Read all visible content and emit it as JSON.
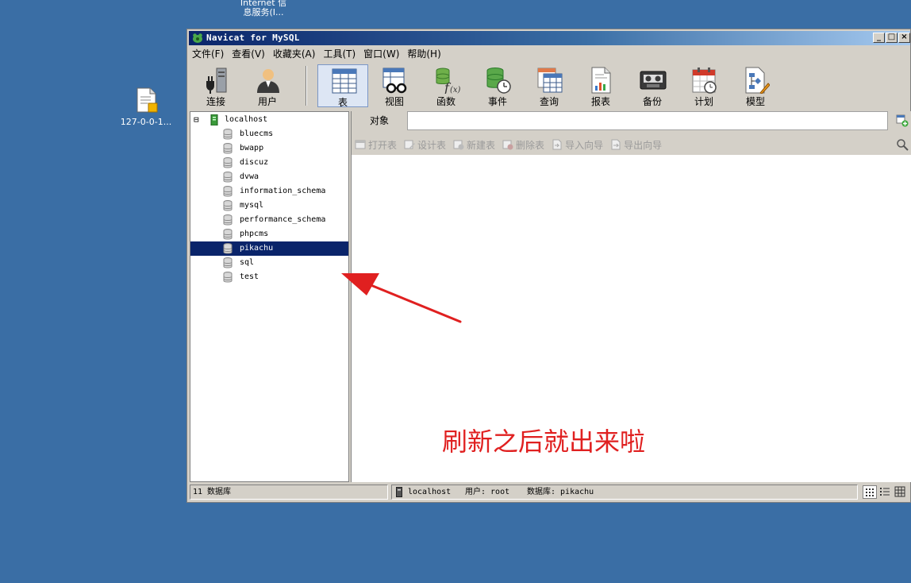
{
  "desktop": {
    "top_icon_label_line1": "Internet 信",
    "top_icon_label_line2": "息服务(I...",
    "file_icon_label": "127-0-0-1..."
  },
  "window": {
    "title": "Navicat for MySQL",
    "min_glyph": "_",
    "max_glyph": "□",
    "close_glyph": "×"
  },
  "menu": [
    "文件(F)",
    "查看(V)",
    "收藏夹(A)",
    "工具(T)",
    "窗口(W)",
    "帮助(H)"
  ],
  "toolbar": [
    {
      "label": "连接",
      "icon": "plug-server-icon"
    },
    {
      "label": "用户",
      "icon": "user-icon"
    },
    {
      "label": "表",
      "icon": "table-icon",
      "active": true
    },
    {
      "label": "视图",
      "icon": "view-glasses-icon"
    },
    {
      "label": "函数",
      "icon": "function-icon"
    },
    {
      "label": "事件",
      "icon": "event-clock-icon"
    },
    {
      "label": "查询",
      "icon": "query-table-icon"
    },
    {
      "label": "报表",
      "icon": "report-icon"
    },
    {
      "label": "备份",
      "icon": "backup-tape-icon"
    },
    {
      "label": "计划",
      "icon": "schedule-calendar-icon"
    },
    {
      "label": "模型",
      "icon": "model-diagram-icon"
    }
  ],
  "tree": {
    "root": "localhost",
    "expander": "⊟",
    "databases": [
      "bluecms",
      "bwapp",
      "discuz",
      "dvwa",
      "information_schema",
      "mysql",
      "performance_schema",
      "phpcms",
      "pikachu",
      "sql",
      "test"
    ],
    "selected": "pikachu"
  },
  "objects": {
    "tab_label": "对象",
    "actions": [
      "打开表",
      "设计表",
      "新建表",
      "删除表",
      "导入向导",
      "导出向导"
    ]
  },
  "status": {
    "db_count": "11 数据库",
    "connection": "localhost",
    "user": "用户: root",
    "database": "数据库: pikachu"
  },
  "annotation": {
    "text": "刷新之后就出来啦",
    "color": "#e02020"
  },
  "colors": {
    "desktop": "#3a6ea5",
    "selection": "#0a246a",
    "titlebar_start": "#0a246a"
  }
}
